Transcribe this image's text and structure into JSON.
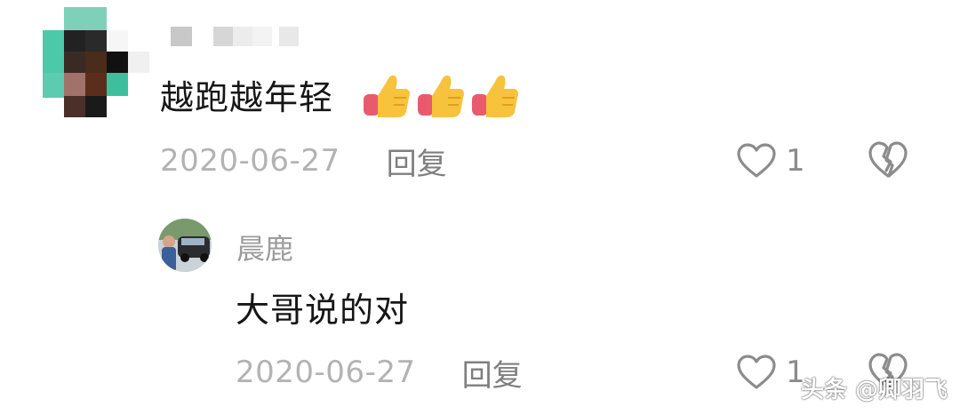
{
  "comment": {
    "text": "越跑越年轻",
    "emoji_icons": [
      "thumbs-up-icon",
      "thumbs-up-icon",
      "thumbs-up-icon"
    ],
    "date": "2020-06-27",
    "reply_label": "回复",
    "like_count": "1",
    "like_icon": "heart-outline-icon",
    "dislike_icon": "broken-heart-icon"
  },
  "reply": {
    "username": "晨鹿",
    "text": "大哥说的对",
    "date": "2020-06-27",
    "reply_label": "回复",
    "like_count": "1",
    "like_icon": "heart-outline-icon",
    "dislike_icon": "broken-heart-icon"
  },
  "watermark": {
    "text": "头条 @卿羽飞"
  },
  "colors": {
    "text_primary": "#161616",
    "date_gray": "#b3b3b3",
    "reply_gray": "#7f7f7f",
    "icon_gray": "#8c8c8c",
    "background": "#ffffff"
  }
}
